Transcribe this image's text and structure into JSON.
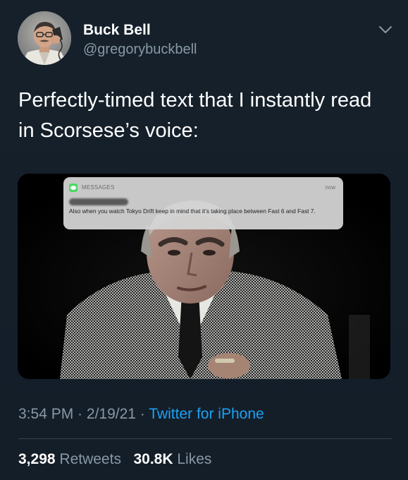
{
  "author": {
    "display_name": "Buck Bell",
    "handle": "@gregorybuckbell"
  },
  "tweet": {
    "text": "Perfectly-timed text that I instantly read in Scorsese’s voice:"
  },
  "media": {
    "notification": {
      "app_name": "MESSAGES",
      "time": "now",
      "body": "Also when you watch Tokyo Drift keep in mind that it’s taking place between Fast 6 and Fast 7."
    }
  },
  "meta": {
    "time": "3:54 PM",
    "separator": " · ",
    "date": "2/19/21",
    "source": "Twitter for iPhone"
  },
  "stats": {
    "retweets_count": "3,298",
    "retweets_label": "Retweets",
    "likes_count": "30.8K",
    "likes_label": "Likes"
  },
  "colors": {
    "background": "#15202b",
    "secondary_text": "#8899a6",
    "link": "#1da1f2",
    "divider": "#38444d",
    "messages_icon": "#4cd964"
  },
  "icons": {
    "more": "chevron-down-icon",
    "notification_app": "messages-app-icon"
  }
}
